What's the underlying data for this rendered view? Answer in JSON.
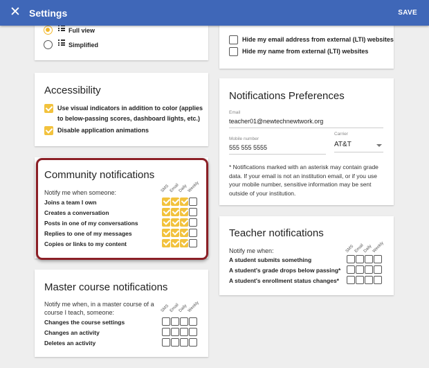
{
  "appbar": {
    "title": "Settings",
    "save_label": "SAVE",
    "close_glyph": "✕"
  },
  "view_card": {
    "options": [
      {
        "label": "Full view",
        "selected": true
      },
      {
        "label": "Simplified",
        "selected": false
      }
    ]
  },
  "lti_card": {
    "items": [
      {
        "label": "Hide my email address from external (LTI) websites",
        "checked": false
      },
      {
        "label": "Hide my name from external (LTI) websites",
        "checked": false
      }
    ]
  },
  "accessibility": {
    "title": "Accessibility",
    "items": [
      {
        "label": "Use visual indicators in addition to color (applies to below-passing scores, dashboard lights, etc.)",
        "checked": true
      },
      {
        "label": "Disable application animations",
        "checked": true
      }
    ]
  },
  "columns": [
    "SMS",
    "Email",
    "Daily",
    "Weekly"
  ],
  "community": {
    "title": "Community notifications",
    "subtitle": "Notify me when someone:",
    "rows": [
      {
        "label": "Joins a team I own",
        "values": [
          true,
          true,
          true,
          false
        ]
      },
      {
        "label": "Creates a conversation",
        "values": [
          true,
          true,
          true,
          false
        ]
      },
      {
        "label": "Posts in one of my conversations",
        "values": [
          true,
          true,
          true,
          false
        ]
      },
      {
        "label": "Replies to one of my messages",
        "values": [
          true,
          true,
          true,
          false
        ]
      },
      {
        "label": "Copies or links to my content",
        "values": [
          true,
          true,
          true,
          false
        ]
      }
    ]
  },
  "master": {
    "title": "Master course notifications",
    "subtitle": "Notify me when, in a master course of a course I teach, someone:",
    "rows": [
      {
        "label": "Changes the course settings",
        "values": [
          false,
          false,
          false,
          false
        ]
      },
      {
        "label": "Changes an activity",
        "values": [
          false,
          false,
          false,
          false
        ]
      },
      {
        "label": "Deletes an activity",
        "values": [
          false,
          false,
          false,
          false
        ]
      }
    ]
  },
  "preferences": {
    "title": "Notifications Preferences",
    "email_label": "Email",
    "email_value": "teacher01@newtechnewtwork.org",
    "mobile_label": "Mobile number",
    "mobile_value": "555 555 5555",
    "carrier_label": "Carrier",
    "carrier_value": "AT&T",
    "note": "* Notifications marked with an asterisk may contain grade data. If your email is not an institution email, or if you use your mobile number, sensitive information may be sent outside of your institution."
  },
  "teacher": {
    "title": "Teacher notifications",
    "subtitle": "Notify me when:",
    "rows": [
      {
        "label": "A student submits something",
        "values": [
          false,
          false,
          false,
          false
        ]
      },
      {
        "label": "A student's grade drops below passing*",
        "values": [
          false,
          false,
          false,
          false
        ]
      },
      {
        "label": "A student's enrollment status changes*",
        "values": [
          false,
          false,
          false,
          false
        ]
      }
    ]
  },
  "colors": {
    "appbar": "#3f67b8",
    "accent": "#f2c23d",
    "highlight": "#8b1f26",
    "background": "#eeeeee"
  }
}
